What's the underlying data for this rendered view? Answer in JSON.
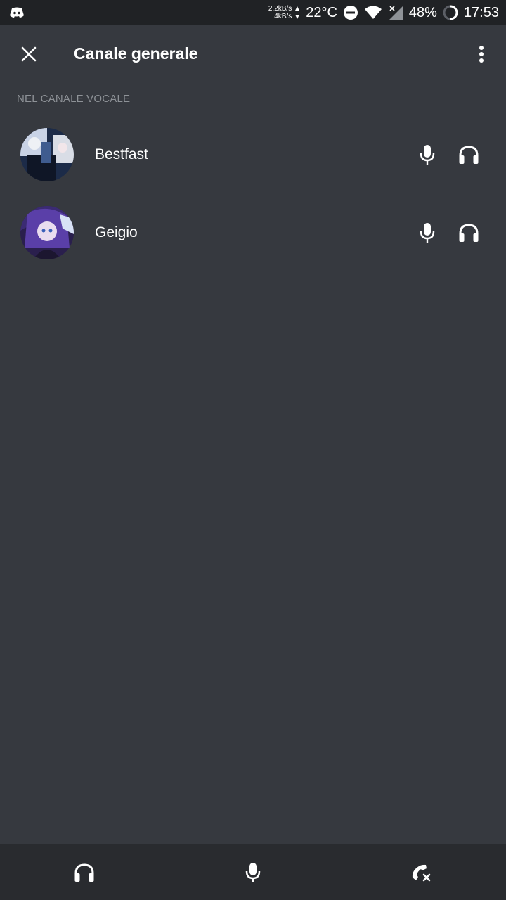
{
  "status_bar": {
    "app_icon": "discord-icon",
    "net_up": "2.2kB/s",
    "net_down": "4kB/s",
    "temperature": "22°C",
    "battery": "48%",
    "time": "17:53"
  },
  "header": {
    "title": "Canale generale",
    "close_icon": "close-icon",
    "menu_icon": "more-vertical-icon"
  },
  "section": {
    "label": "NEL CANALE VOCALE"
  },
  "users": [
    {
      "name": "Bestfast",
      "avatar_colors": [
        "#1c2b48",
        "#c9d3e6"
      ]
    },
    {
      "name": "Geigio",
      "avatar_colors": [
        "#2a1f4d",
        "#7b5cc4"
      ]
    }
  ],
  "bottom_bar": {
    "icons": [
      "headphones-icon",
      "microphone-icon",
      "disconnect-call-icon"
    ]
  },
  "colors": {
    "background": "#36393f",
    "status_bar": "#202225",
    "bottom_bar": "#292b2f",
    "muted_text": "#8e9297"
  }
}
